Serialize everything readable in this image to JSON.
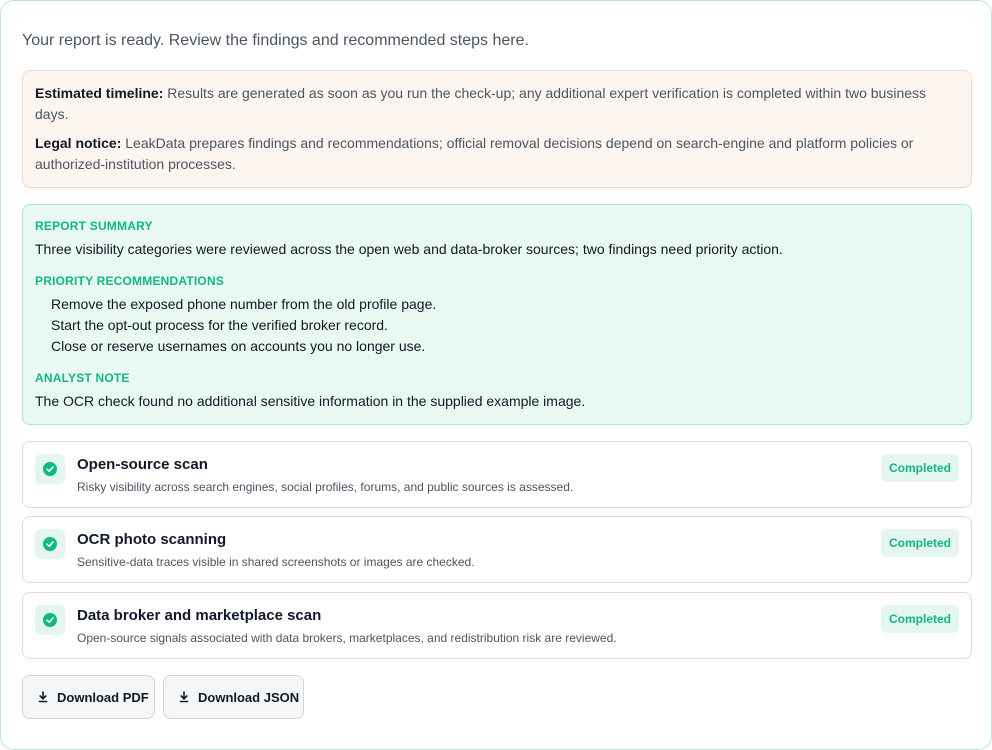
{
  "intro": "Your report is ready. Review the findings and recommended steps here.",
  "notice": {
    "timeline_label": "Estimated timeline:",
    "timeline_text": "Results are generated as soon as you run the check-up; any additional expert verification is completed within two business days.",
    "legal_label": "Legal notice:",
    "legal_text": "LeakData prepares findings and recommendations; official removal decisions depend on search-engine and platform policies or authorized-institution processes."
  },
  "summary": {
    "summary_heading": "REPORT SUMMARY",
    "summary_text": "Three visibility categories were reviewed across the open web and data-broker sources; two findings need priority action.",
    "priority_heading": "PRIORITY RECOMMENDATIONS",
    "recommendations": [
      "Remove the exposed phone number from the old profile page.",
      "Start the opt-out process for the verified broker record.",
      "Close or reserve usernames on accounts you no longer use."
    ],
    "note_heading": "ANALYST NOTE",
    "note_text": "The OCR check found no additional sensitive information in the supplied example image."
  },
  "steps": [
    {
      "title": "Open-source scan",
      "desc": "Risky visibility across search engines, social profiles, forums, and public sources is assessed.",
      "status": "Completed"
    },
    {
      "title": "OCR photo scanning",
      "desc": "Sensitive-data traces visible in shared screenshots or images are checked.",
      "status": "Completed"
    },
    {
      "title": "Data broker and marketplace scan",
      "desc": "Open-source signals associated with data brokers, marketplaces, and redistribution risk are reviewed.",
      "status": "Completed"
    }
  ],
  "buttons": {
    "pdf": "Download PDF",
    "json": "Download JSON"
  },
  "colors": {
    "accent": "#10b981",
    "summary_bg": "#e9f8f1",
    "notice_bg": "#fdf5f0"
  }
}
